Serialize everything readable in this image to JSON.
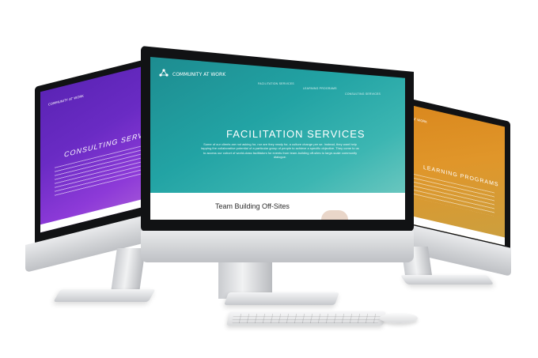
{
  "left_screen": {
    "logo": "COMMUNITY AT WORK",
    "title": "CONSULTING SERVICES",
    "color": "#6a2bc4"
  },
  "center_screen": {
    "logo": "COMMUNITY AT WORK",
    "nav": [
      "FACILITATION SERVICES",
      "LEARNING PROGRAMS",
      "CONSULTING SERVICES"
    ],
    "title": "FACILITATION SERVICES",
    "body": "Some of our clients are not asking for, nor are they ready for, a culture change per se. Instead, they want help tapping the collaborative potential of a particular group of people to achieve a specific objective. They come to us to access our cohort of world-class facilitators for events from team-building off-sites to large-scale community dialogue.",
    "section_heading": "Team Building Off-Sites",
    "color": "#22a3a4"
  },
  "right_screen": {
    "logo": "COMMUNITY AT WORK",
    "title": "LEARNING PROGRAMS",
    "color": "#d9861c"
  },
  "icons": [
    "apple-logo-icon",
    "community-at-work-logo-icon"
  ]
}
